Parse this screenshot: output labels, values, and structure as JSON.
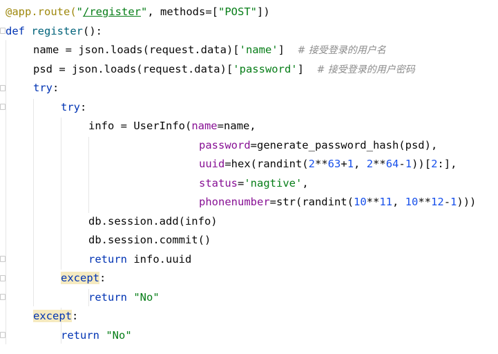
{
  "lines": [
    {
      "t": [
        "@app.route(",
        "\"",
        "/register",
        "\"",
        ", methods=[",
        "\"POST\"",
        "])"
      ]
    },
    {
      "t": [
        "def",
        " ",
        "register",
        "():"
      ]
    },
    {
      "t": [
        "name = json.loads(request.data)[",
        "'name'",
        "]  ",
        "# 接受登录的用户名"
      ]
    },
    {
      "t": [
        "psd = json.loads(request.data)[",
        "'password'",
        "]  ",
        "# 接受登录的用户密码"
      ]
    },
    {
      "t": [
        "try",
        ":"
      ]
    },
    {
      "t": [
        "try",
        ":"
      ]
    },
    {
      "t": [
        "info = UserInfo(",
        "name",
        "=name,"
      ]
    },
    {
      "t": [
        "password",
        "=generate_password_hash(psd),"
      ]
    },
    {
      "t": [
        "uuid",
        "=hex(randint(",
        "2",
        "**",
        "63",
        "+",
        "1",
        ", ",
        "2",
        "**",
        "64",
        "-",
        "1",
        "))[",
        "2",
        ":],"
      ]
    },
    {
      "t": [
        "status",
        "=",
        "'nagtive'",
        ","
      ]
    },
    {
      "t": [
        "phonenumber",
        "=str(randint(",
        "10",
        "**",
        "11",
        ", ",
        "10",
        "**",
        "12",
        "-",
        "1",
        ")))"
      ]
    },
    {
      "t": [
        "db.session.add(info)"
      ]
    },
    {
      "t": [
        "db.session.commit()"
      ]
    },
    {
      "t": [
        "return",
        " info.uuid"
      ]
    },
    {
      "t": [
        "except",
        ":"
      ]
    },
    {
      "t": [
        "return",
        " ",
        "\"No\""
      ]
    },
    {
      "t": [
        "except",
        ":"
      ]
    },
    {
      "t": [
        "return",
        " ",
        "\"No\""
      ]
    }
  ]
}
